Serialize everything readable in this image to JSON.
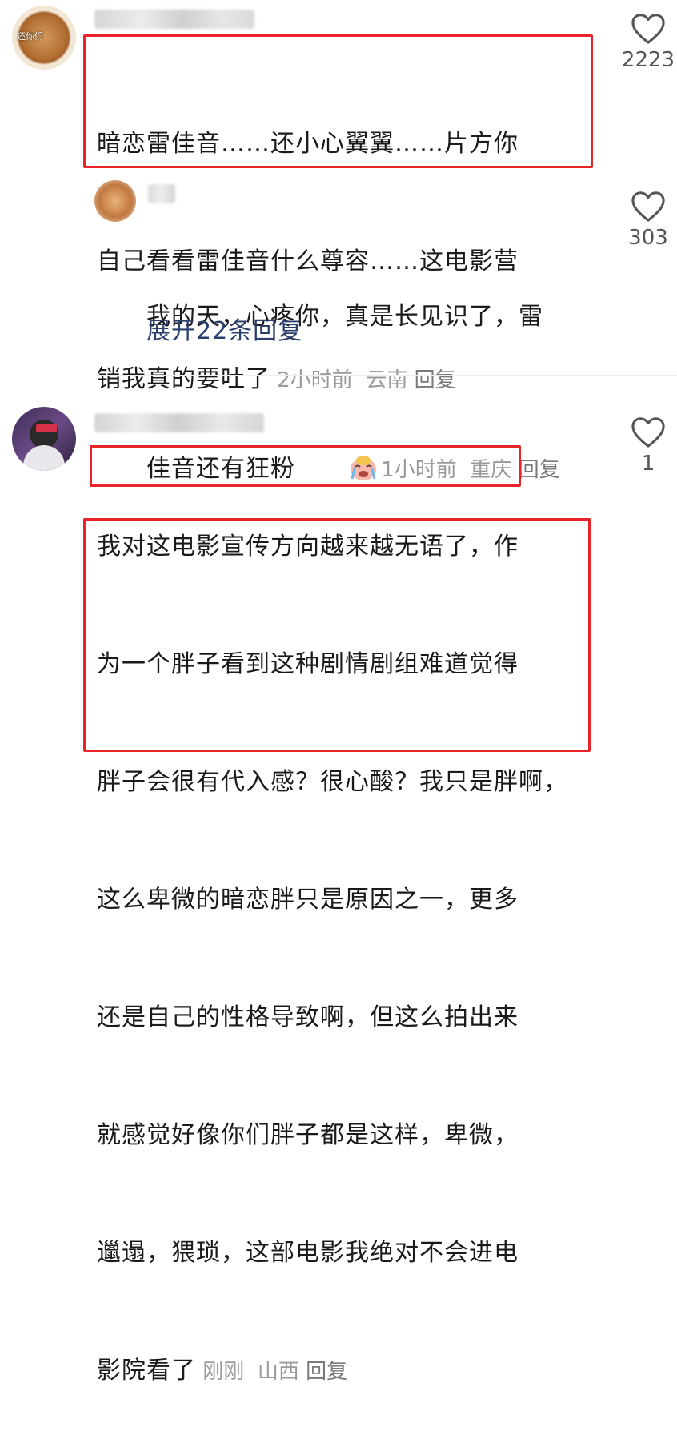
{
  "colors": {
    "highlight_box": "#e8232a",
    "meta_text": "#9a9a9a",
    "expand_link": "#2a3f6a"
  },
  "comments": [
    {
      "avatar_icon": "mooncake-avatar-icon",
      "avatar_text": "还你们",
      "text_lines": [
        "暗恋雷佳音……还小心翼翼……片方你",
        "自己看看雷佳音什么尊容……这电影营",
        "销我真的要吐了"
      ],
      "time": "2小时前",
      "location": "云南",
      "reply_label": "回复",
      "likes": "2223",
      "replies": [
        {
          "avatar_icon": "tiger-avatar-icon",
          "text_lines": [
            "我的天，心疼你，真是长见识了，雷",
            "佳音还有狂粉"
          ],
          "emoji": "crying-face-emoji",
          "time": "1小时前",
          "location": "重庆",
          "reply_label": "回复",
          "likes": "303"
        }
      ],
      "expand_label": "展开22条回复"
    },
    {
      "avatar_icon": "person-avatar-icon",
      "text_lines": [
        "我对这电影宣传方向越来越无语了，作",
        "为一个胖子看到这种剧情剧组难道觉得",
        "胖子会很有代入感？很心酸？我只是胖啊，",
        "这么卑微的暗恋胖只是原因之一，更多",
        "还是自己的性格导致啊，但这么拍出来",
        "就感觉好像你们胖子都是这样，卑微，",
        "邋遢，猥琐，这部电影我绝对不会进电",
        "影院看了"
      ],
      "time": "刚刚",
      "location": "山西",
      "reply_label": "回复",
      "likes": "1"
    }
  ]
}
